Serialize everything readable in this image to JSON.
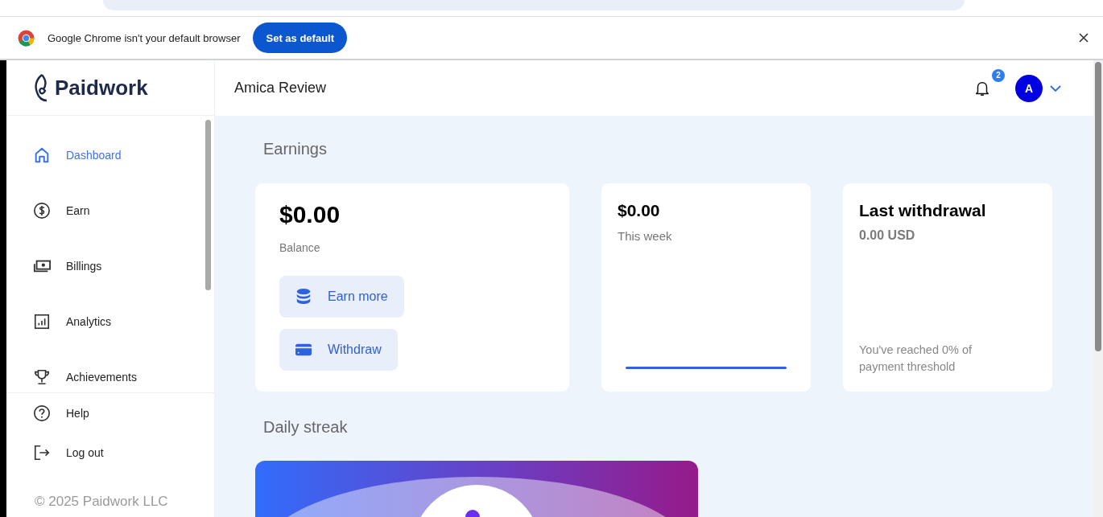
{
  "infobar": {
    "message": "Google Chrome isn't your default browser",
    "button": "Set as default"
  },
  "logo": {
    "text": "Paidwork"
  },
  "sidebar": {
    "items": [
      {
        "label": "Dashboard",
        "kind": "home",
        "selected": true
      },
      {
        "label": "Earn",
        "kind": "dollar",
        "selected": false
      },
      {
        "label": "Billings",
        "kind": "cash",
        "selected": false
      },
      {
        "label": "Analytics",
        "kind": "chart",
        "selected": false
      },
      {
        "label": "Achievements",
        "kind": "trophy",
        "selected": false
      }
    ],
    "bottom_items": [
      {
        "label": "Help",
        "kind": "help"
      },
      {
        "label": "Log out",
        "kind": "logout"
      }
    ],
    "footer": "© 2025 Paidwork LLC"
  },
  "header": {
    "title": "Amica Review",
    "notification_count": "2",
    "avatar_initial": "A"
  },
  "earnings": {
    "heading": "Earnings",
    "balance": {
      "amount": "$0.00",
      "label": "Balance",
      "buttons": [
        {
          "label": "Earn more",
          "kind": "coins"
        },
        {
          "label": "Withdraw",
          "kind": "card"
        }
      ]
    },
    "week": {
      "amount": "$0.00",
      "label": "This week"
    },
    "last_withdrawal": {
      "title": "Last withdrawal",
      "amount": "0.00 USD",
      "note": "You've reached 0% of payment threshold"
    }
  },
  "daily_streak": {
    "heading": "Daily streak"
  }
}
